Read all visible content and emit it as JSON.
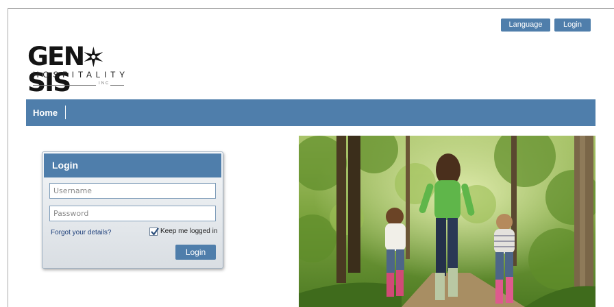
{
  "header": {
    "language_label": "Language",
    "login_label": "Login"
  },
  "logo": {
    "word": "GENESIS",
    "sub": "HOSPITALITY",
    "inc": "INC"
  },
  "nav": {
    "home_label": "Home"
  },
  "login_panel": {
    "title": "Login",
    "username_placeholder": "Username",
    "password_placeholder": "Password",
    "forgot_label": "Forgot your details?",
    "keep_logged_in_label": "Keep me logged in",
    "keep_logged_in_checked": true,
    "submit_label": "Login"
  },
  "colors": {
    "accent": "#4f7eab",
    "link": "#1d3f7a"
  },
  "hero": {
    "icon": "family-walking-in-forest-photo"
  }
}
